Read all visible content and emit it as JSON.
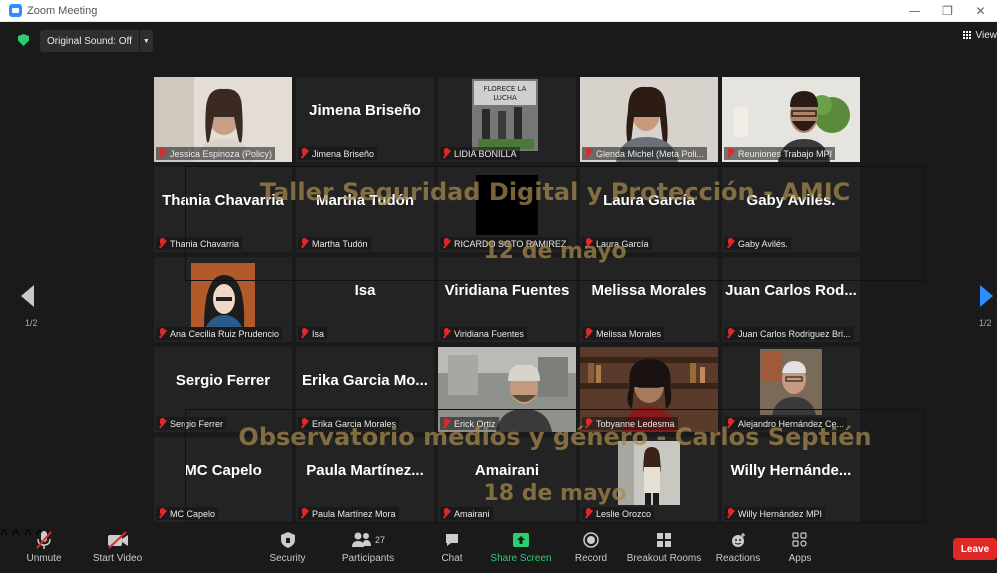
{
  "window": {
    "title": "Zoom Meeting",
    "min": "—",
    "restore": "❐",
    "close": "✕"
  },
  "topbar": {
    "original_sound": "Original Sound: Off",
    "view_label": "View"
  },
  "overlay": {
    "top_line1": "Taller Seguridad Digital y Protección - AMIC",
    "top_line2": "12 de mayo",
    "bottom_line1": "Observatorio medios y género - Carlos Septién",
    "bottom_line2": "18 de mayo"
  },
  "pagination": {
    "left": "1/2",
    "right": "1/2"
  },
  "tiles": [
    {
      "big": "",
      "label": "Jessica Espinoza (Policy)",
      "video": "woman-glasses"
    },
    {
      "big": "Jimena Briseño",
      "label": "Jimena Briseño",
      "video": ""
    },
    {
      "big": "",
      "label": "LIDIA BONILLA",
      "video": "poster"
    },
    {
      "big": "",
      "label": "Glenda Michel (Meta Poli...",
      "video": "woman-curly"
    },
    {
      "big": "",
      "label": "Reuniones Trabajo MPI",
      "video": "man-beard"
    },
    {
      "big": "Thania Chavarria",
      "label": "Thania Chavarria",
      "video": ""
    },
    {
      "big": "Martha Tudón",
      "label": "Martha Tudón",
      "video": ""
    },
    {
      "big": "",
      "label": "RICARDO SOTO RAMIREZ",
      "video": "black"
    },
    {
      "big": "Laura García",
      "label": "Laura García",
      "video": ""
    },
    {
      "big": "Gaby Avilés.",
      "label": "Gaby Avilés.",
      "video": ""
    },
    {
      "big": "",
      "label": "Ana Cecilia Ruiz Prudencio",
      "video": "cartoon"
    },
    {
      "big": "Isa",
      "label": "Isa",
      "video": ""
    },
    {
      "big": "Viridiana Fuentes",
      "label": "Viridiana Fuentes",
      "video": ""
    },
    {
      "big": "Melissa Morales",
      "label": "Melissa Morales",
      "video": ""
    },
    {
      "big": "Juan Carlos Rod...",
      "label": "Juan Carlos Rodriguez Bri...",
      "video": ""
    },
    {
      "big": "Sergio Ferrer",
      "label": "Sergio Ferrer",
      "video": ""
    },
    {
      "big": "Erika Garcia Mo...",
      "label": "Erika Garcia Morales",
      "video": ""
    },
    {
      "big": "",
      "label": "Erick Ortiz",
      "video": "man-office"
    },
    {
      "big": "",
      "label": "Tobyanne Ledesma",
      "video": "woman-bookshelf"
    },
    {
      "big": "",
      "label": "Alejandro Hernández Ce...",
      "video": "man-old"
    },
    {
      "big": "MC Capelo",
      "label": "MC Capelo",
      "video": ""
    },
    {
      "big": "Paula Martínez...",
      "label": "Paula Martínez Mora",
      "video": ""
    },
    {
      "big": "Amairani",
      "label": "Amairani",
      "video": ""
    },
    {
      "big": "",
      "label": "Leslie Orozco",
      "video": "woman-standing"
    },
    {
      "big": "Willy Hernánde...",
      "label": "Willy Hernández MPI",
      "video": ""
    }
  ],
  "toolbar": {
    "unmute": "Unmute",
    "start_video": "Start Video",
    "security": "Security",
    "participants": "Participants",
    "participants_count": "27",
    "chat": "Chat",
    "share_screen": "Share Screen",
    "record": "Record",
    "breakout_rooms": "Breakout Rooms",
    "reactions": "Reactions",
    "apps": "Apps",
    "leave": "Leave"
  },
  "colors": {
    "accent": "#2d8cff",
    "share": "#2ecc71",
    "leave": "#e02828",
    "active_speaker": "#c8d96a"
  }
}
